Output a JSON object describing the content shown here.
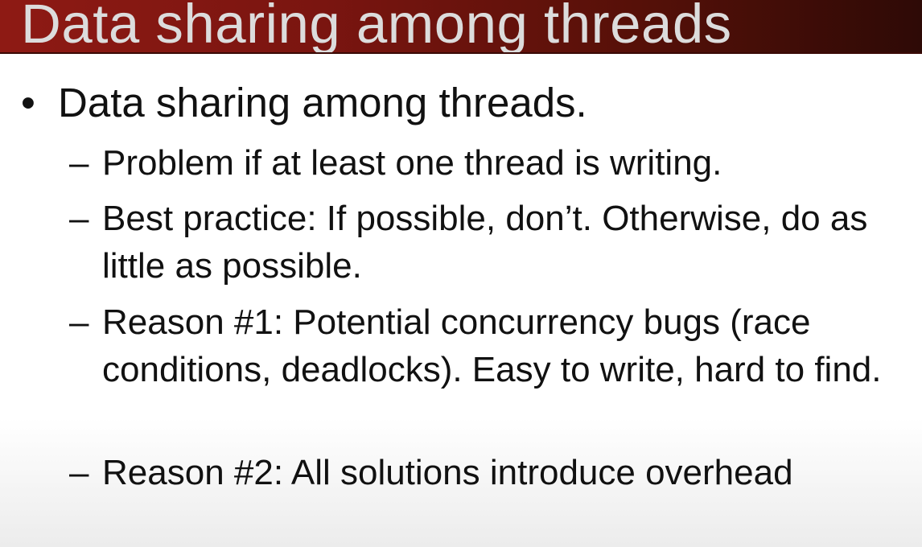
{
  "slide": {
    "title": "Data sharing among threads",
    "bullet": {
      "marker": "•",
      "text": "Data sharing among threads."
    },
    "sub_bullets": [
      {
        "marker": "–",
        "text": "Problem if at least one thread is writing."
      },
      {
        "marker": "–",
        "text": "Best practice: If possible, don’t. Otherwise, do as little as possible."
      },
      {
        "marker": "–",
        "text": "Reason #1: Potential concurrency bugs (race conditions, deadlocks). Easy to write, hard to find."
      },
      {
        "marker": "–",
        "text": "Reason #2: All solutions introduce overhead"
      }
    ]
  },
  "colors": {
    "title_bar_start": "#8e1a14",
    "title_bar_end": "#2e0a06",
    "title_text": "#dcdcdc",
    "body_text": "#111111",
    "background": "#ffffff"
  }
}
